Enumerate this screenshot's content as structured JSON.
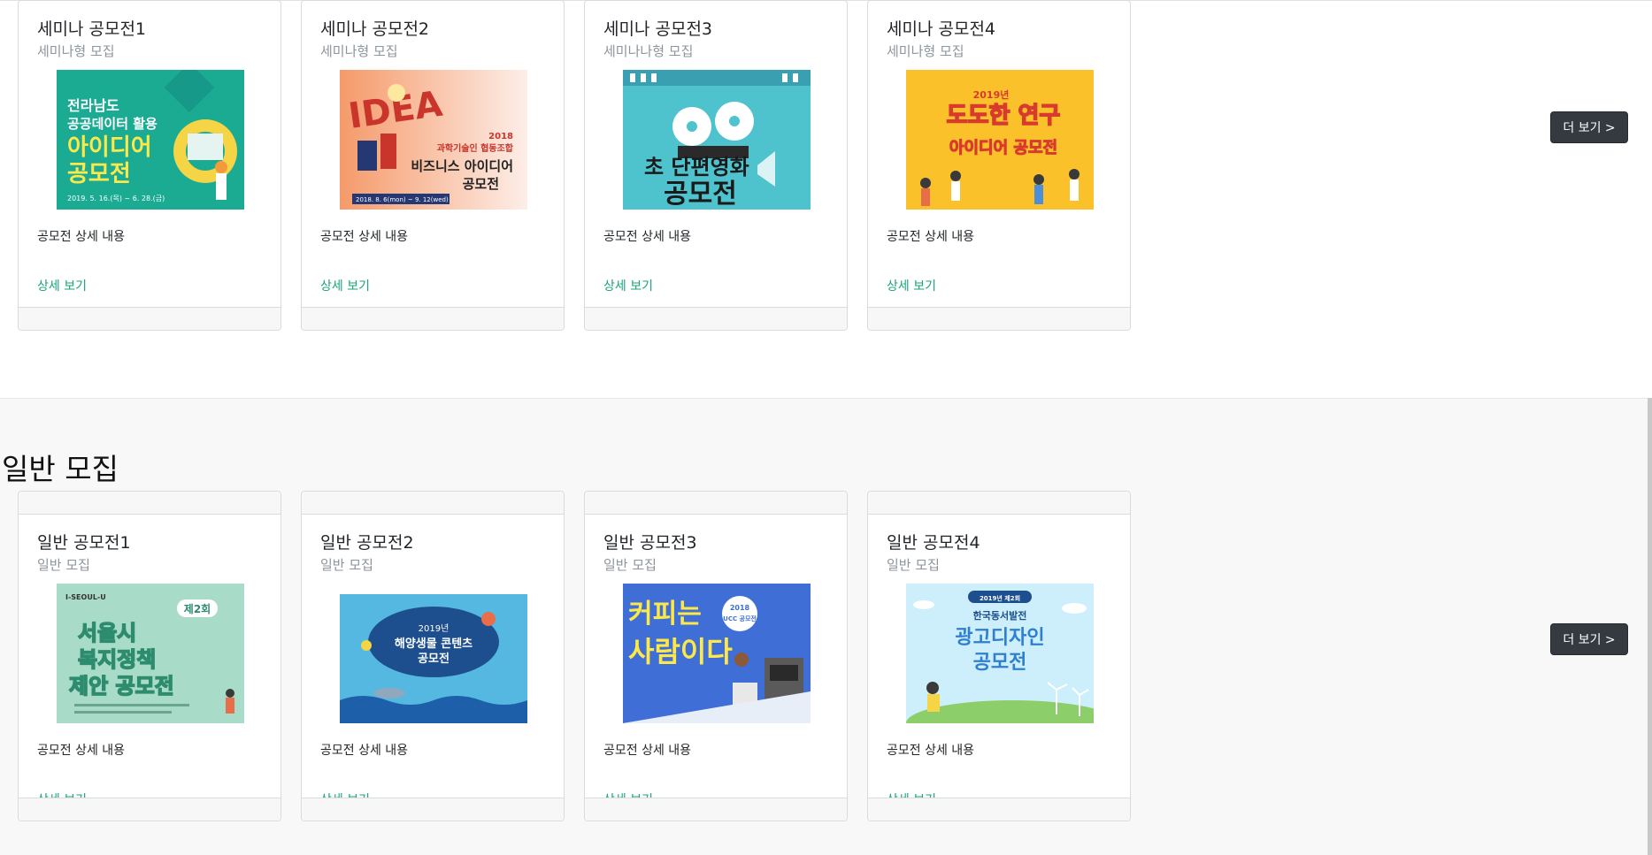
{
  "seminar": {
    "cards": [
      {
        "title": "세미나 공모전1",
        "subtitle": "세미나형 모집",
        "text": "공모전 상세 내용",
        "link": "상세 보기",
        "poster": {
          "bg": "#1bab93",
          "lines": [
            "전라남도",
            "공공데이터 활용",
            "아이디어",
            "공모전"
          ],
          "date": "2019. 5. 16.(목) ~ 6. 28.(금)",
          "icon": "pie-chart-illustration"
        }
      },
      {
        "title": "세미나 공모전2",
        "subtitle": "세미나형 모집",
        "text": "공모전 상세 내용",
        "link": "상세 보기",
        "poster": {
          "bg": "#fbe3d8",
          "lines": [
            "2018",
            "과학기술인 협동조합",
            "비즈니스 아이디어",
            "공모전"
          ],
          "date": "2018. 8. 6(mon) ~ 9. 12(wed)",
          "icon": "idea-blocks-illustration"
        }
      },
      {
        "title": "세미나 공모전3",
        "subtitle": "세미나나형 모집",
        "text": "공모전 상세 내용",
        "link": "상세 보기",
        "poster": {
          "bg": "#4ec3cd",
          "lines": [
            "초 단편영화",
            "공모전"
          ],
          "date": "",
          "icon": "film-reel-illustration"
        }
      },
      {
        "title": "세미나 공모전4",
        "subtitle": "세미나형 모집",
        "text": "공모전 상세 내용",
        "link": "상세 보기",
        "poster": {
          "bg": "#fbc12a",
          "lines": [
            "2019년",
            "도도한 연구",
            "아이디어 공모전"
          ],
          "date": "",
          "icon": "people-illustration"
        }
      }
    ],
    "more_label": "더 보기 >"
  },
  "general": {
    "heading": "일반 모집",
    "cards": [
      {
        "title": "일반 공모전1",
        "subtitle": "일반 모집",
        "text": "공모전 상세 내용",
        "link": "상세 보기",
        "poster": {
          "bg": "#a9dcc8",
          "lines": [
            "I-SEOUL-U",
            "제2회",
            "서울시",
            "복지정책",
            "제안 공모전"
          ],
          "date": "",
          "icon": "people-illustration"
        }
      },
      {
        "title": "일반 공모전2",
        "subtitle": "일반 모집",
        "text": "공모전 상세 내용",
        "link": "상세 보기",
        "poster": {
          "bg": "#55b8e0",
          "lines": [
            "2019년",
            "해양생물 콘텐츠",
            "공모전"
          ],
          "date": "",
          "icon": "sea-life-illustration"
        }
      },
      {
        "title": "일반 공모전3",
        "subtitle": "일반 모집",
        "text": "공모전 상세 내용",
        "link": "상세 보기",
        "poster": {
          "bg": "#3f6fd6",
          "lines": [
            "커피는",
            "사람이다.",
            "2018",
            "UCC 공모전"
          ],
          "date": "",
          "icon": "coffee-machine-illustration"
        }
      },
      {
        "title": "일반 공모전4",
        "subtitle": "일반 모집",
        "text": "공모전 상세 내용",
        "link": "상세 보기",
        "poster": {
          "bg": "#cdeefb",
          "lines": [
            "2019년 제2회",
            "한국동서발전",
            "광고디자인",
            "공모전"
          ],
          "date": "",
          "icon": "wind-turbine-illustration"
        }
      }
    ],
    "more_label": "더 보기 >"
  }
}
